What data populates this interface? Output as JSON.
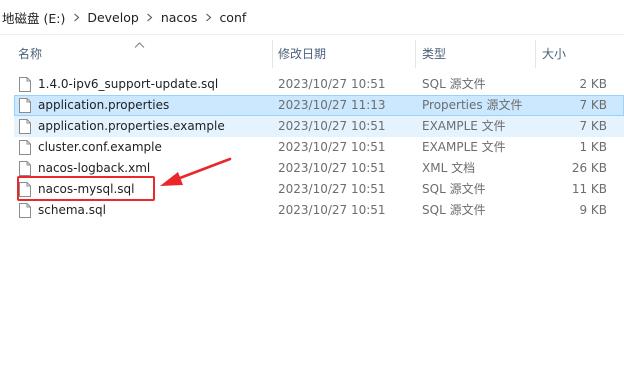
{
  "breadcrumb": [
    "地磁盘 (E:)",
    "Develop",
    "nacos",
    "conf"
  ],
  "columns": {
    "name": "名称",
    "date": "修改日期",
    "type": "类型",
    "size": "大小"
  },
  "files": [
    {
      "name": "1.4.0-ipv6_support-update.sql",
      "date": "2023/10/27 10:51",
      "type": "SQL 源文件",
      "size": "2 KB",
      "state": "normal"
    },
    {
      "name": "application.properties",
      "date": "2023/10/27 11:13",
      "type": "Properties 源文件",
      "size": "7 KB",
      "state": "selected"
    },
    {
      "name": "application.properties.example",
      "date": "2023/10/27 10:51",
      "type": "EXAMPLE 文件",
      "size": "7 KB",
      "state": "hover"
    },
    {
      "name": "cluster.conf.example",
      "date": "2023/10/27 10:51",
      "type": "EXAMPLE 文件",
      "size": "1 KB",
      "state": "normal"
    },
    {
      "name": "nacos-logback.xml",
      "date": "2023/10/27 10:51",
      "type": "XML 文档",
      "size": "26 KB",
      "state": "normal"
    },
    {
      "name": "nacos-mysql.sql",
      "date": "2023/10/27 10:51",
      "type": "SQL 源文件",
      "size": "11 KB",
      "state": "normal"
    },
    {
      "name": "schema.sql",
      "date": "2023/10/27 10:51",
      "type": "SQL 源文件",
      "size": "9 KB",
      "state": "normal"
    }
  ],
  "colors": {
    "selected_bg": "#cce8ff",
    "hover_bg": "#e5f3ff",
    "annotation": "#e8282b",
    "header_text": "#4c607a"
  },
  "annotation": {
    "target": "nacos-mysql.sql",
    "shape": "red-box-with-arrow"
  },
  "icons": {
    "separator": "chevron-right-icon",
    "sort": "sort-up-icon",
    "file": "file-icon"
  }
}
